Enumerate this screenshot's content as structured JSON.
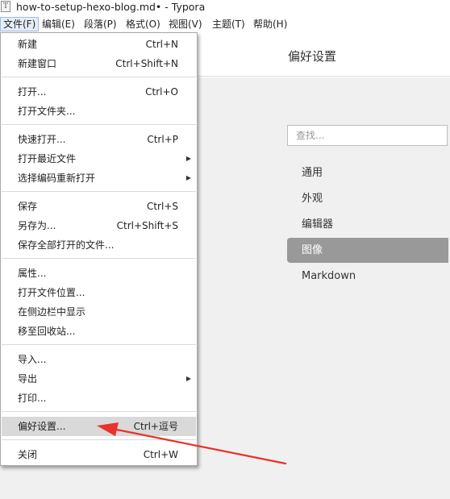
{
  "window": {
    "icon_letter": "T",
    "title": "how-to-setup-hexo-blog.md• - Typora"
  },
  "menubar": {
    "items": [
      {
        "label": "文件(F)"
      },
      {
        "label": "编辑(E)"
      },
      {
        "label": "段落(P)"
      },
      {
        "label": "格式(O)"
      },
      {
        "label": "视图(V)"
      },
      {
        "label": "主题(T)"
      },
      {
        "label": "帮助(H)"
      }
    ]
  },
  "file_menu": {
    "items": [
      {
        "label": "新建",
        "shortcut": "Ctrl+N"
      },
      {
        "label": "新建窗口",
        "shortcut": "Ctrl+Shift+N"
      },
      {
        "label": "打开...",
        "shortcut": "Ctrl+O"
      },
      {
        "label": "打开文件夹...",
        "shortcut": ""
      },
      {
        "label": "快速打开...",
        "shortcut": "Ctrl+P"
      },
      {
        "label": "打开最近文件",
        "shortcut": ""
      },
      {
        "label": "选择编码重新打开",
        "shortcut": ""
      },
      {
        "label": "保存",
        "shortcut": "Ctrl+S"
      },
      {
        "label": "另存为...",
        "shortcut": "Ctrl+Shift+S"
      },
      {
        "label": "保存全部打开的文件...",
        "shortcut": ""
      },
      {
        "label": "属性...",
        "shortcut": ""
      },
      {
        "label": "打开文件位置...",
        "shortcut": ""
      },
      {
        "label": "在侧边栏中显示",
        "shortcut": ""
      },
      {
        "label": "移至回收站...",
        "shortcut": ""
      },
      {
        "label": "导入...",
        "shortcut": ""
      },
      {
        "label": "导出",
        "shortcut": ""
      },
      {
        "label": "打印...",
        "shortcut": ""
      },
      {
        "label": "偏好设置...",
        "shortcut": "Ctrl+逗号"
      },
      {
        "label": "关闭",
        "shortcut": "Ctrl+W"
      }
    ],
    "submenu_arrow": "▶"
  },
  "preferences": {
    "title": "偏好设置",
    "search_placeholder": "查找...",
    "nav": [
      {
        "label": "通用"
      },
      {
        "label": "外观"
      },
      {
        "label": "编辑器"
      },
      {
        "label": "图像"
      },
      {
        "label": "Markdown"
      }
    ]
  },
  "colors": {
    "annotation_arrow": "#e8322b",
    "selected_nav": "#999999",
    "menu_highlight": "#d9d9d9"
  }
}
